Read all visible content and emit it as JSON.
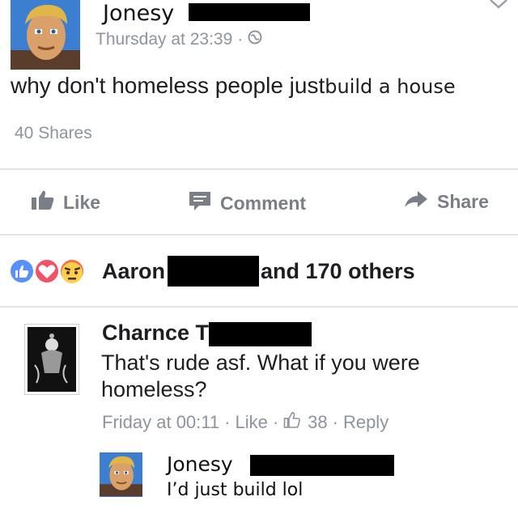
{
  "post": {
    "author": "Jonesy",
    "time": "Thursday at 23:39",
    "separator": "·",
    "text_main": "why don't homeless people just",
    "text_edited": "build a house",
    "shares": "40 Shares"
  },
  "actions": {
    "like_label": "Like",
    "comment_label": "Comment",
    "share_label": "Share"
  },
  "reactions": {
    "name": "Aaron",
    "others": "and 170 others",
    "icons": [
      "like-reaction-icon",
      "love-reaction-icon",
      "angry-reaction-icon"
    ]
  },
  "comment": {
    "author": "Charnce T",
    "text": "That's rude asf. What if you were homeless?",
    "time": "Friday at 00:11",
    "separator1": "·",
    "like_label": "Like",
    "separator2": "·",
    "like_count": "38",
    "separator3": "·",
    "reply_label": "Reply"
  },
  "reply": {
    "author": "Jonesy",
    "text": "I’d just build lol"
  },
  "colors": {
    "meta_gray": "#8d949e",
    "divider": "#e3e4e8",
    "like_blue": "#5890ff",
    "love_red": "#f25268",
    "angry_orange": "#f7714b"
  }
}
